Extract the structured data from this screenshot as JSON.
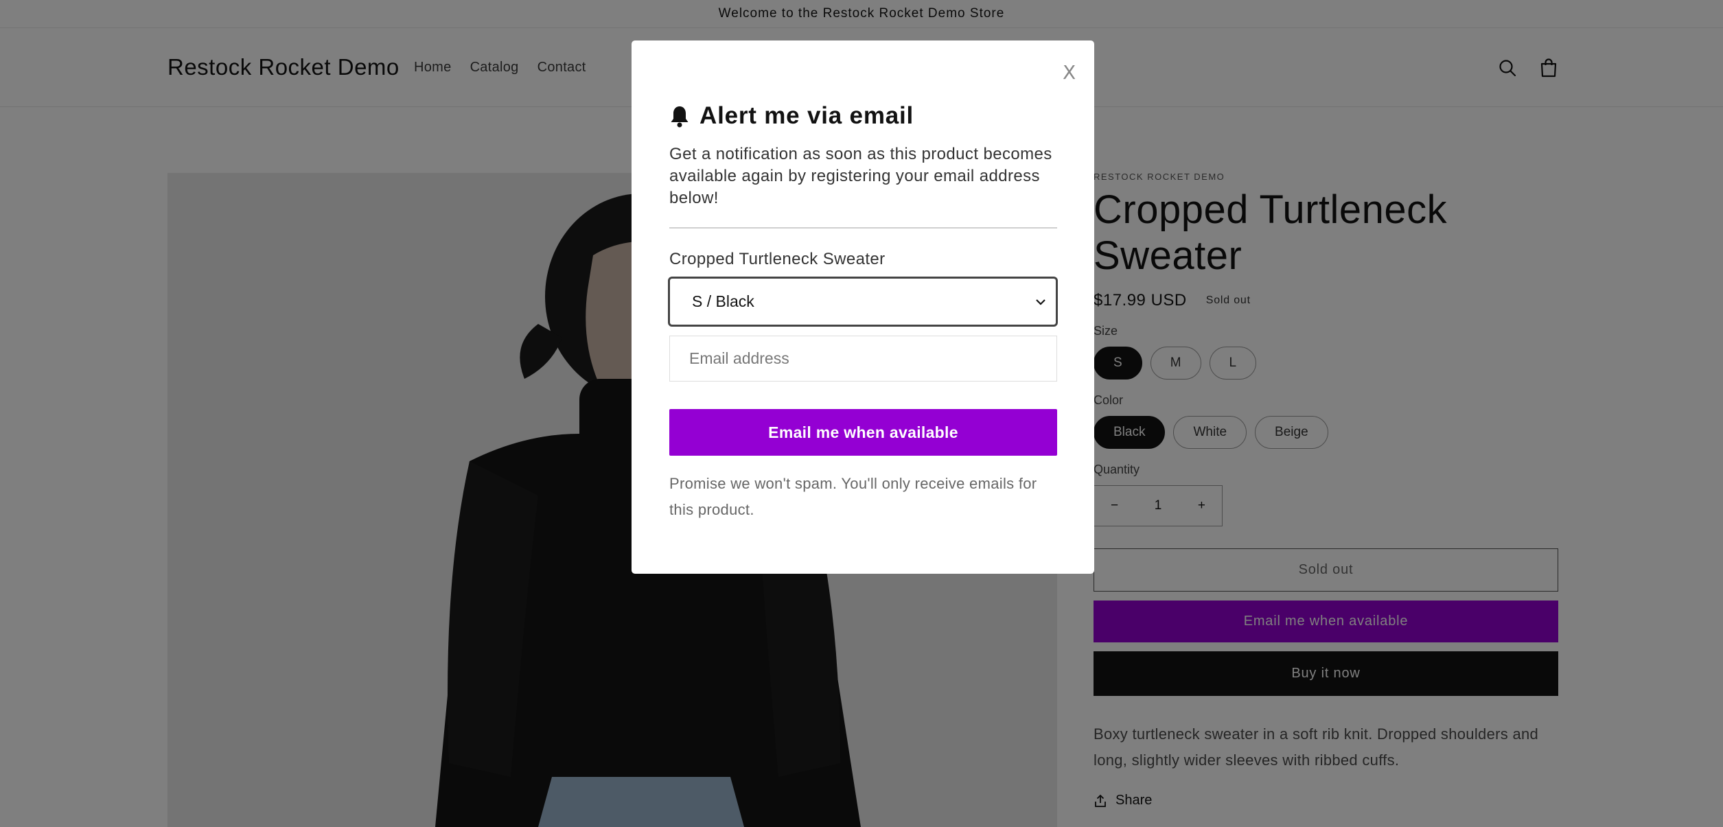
{
  "announcement": "Welcome to the Restock Rocket Demo Store",
  "header": {
    "logo": "Restock Rocket Demo",
    "nav": [
      "Home",
      "Catalog",
      "Contact"
    ],
    "icons": [
      "search-icon",
      "cart-icon"
    ]
  },
  "product": {
    "vendor": "RESTOCK ROCKET DEMO",
    "title": "Cropped Turtleneck Sweater",
    "price": "$17.99 USD",
    "badge": "Sold out",
    "size_label": "Size",
    "sizes": [
      "S",
      "M",
      "L"
    ],
    "selected_size": "S",
    "color_label": "Color",
    "colors": [
      "Black",
      "White",
      "Beige"
    ],
    "selected_color": "Black",
    "quantity_label": "Quantity",
    "quantity": "1",
    "qty_minus": "−",
    "qty_plus": "+",
    "sold_out_button": "Sold out",
    "notify_button": "Email me when available",
    "buy_now_button": "Buy it now",
    "description": "Boxy turtleneck sweater in a soft rib knit. Dropped shoulders and long, slightly wider sleeves with ribbed cuffs.",
    "share_label": "Share"
  },
  "modal": {
    "close_label": "X",
    "title": "Alert me via email",
    "text": "Get a notification as soon as this product becomes available again by registering your email address below!",
    "product_name": "Cropped Turtleneck Sweater",
    "variant_selected": "S / Black",
    "email_placeholder": "Email address",
    "submit_label": "Email me when available",
    "note": "Promise we won't spam. You'll only receive emails for this product.",
    "accent_color": "#9400d3"
  }
}
